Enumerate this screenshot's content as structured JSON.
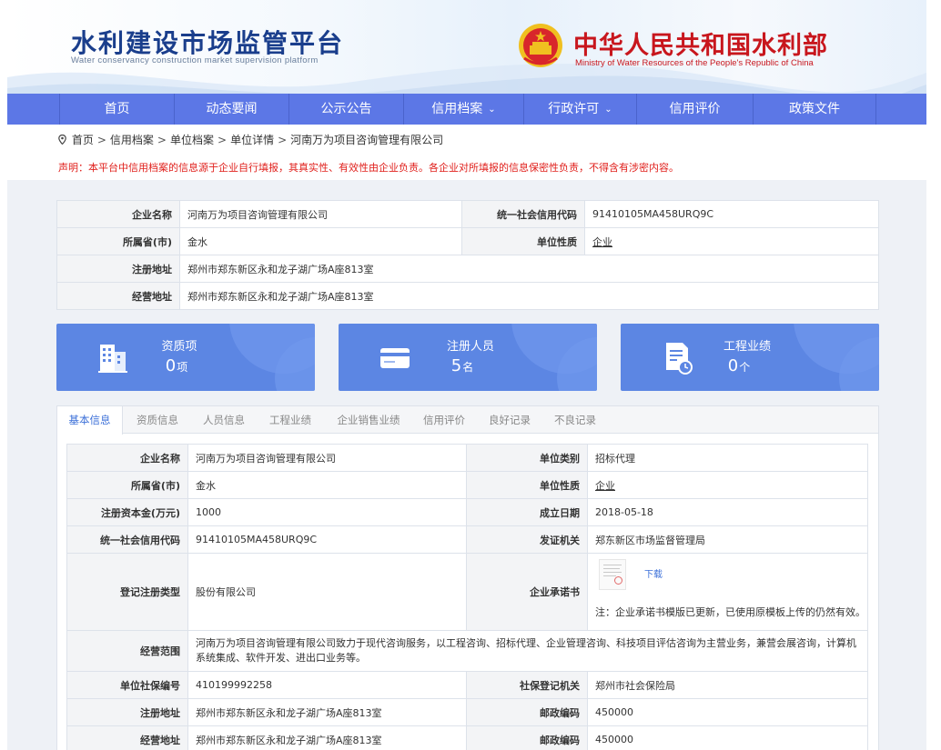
{
  "header": {
    "site_title": "水利建设市场监管平台",
    "site_subtitle": "Water conservancy construction market supervision platform",
    "ministry_cn": "中华人民共和国水利部",
    "ministry_en": "Ministry of Water Resources of the People's Republic of China"
  },
  "nav": {
    "items": [
      {
        "label": "首页"
      },
      {
        "label": "动态要闻"
      },
      {
        "label": "公示公告"
      },
      {
        "label": "信用档案",
        "dropdown": true
      },
      {
        "label": "行政许可",
        "dropdown": true
      },
      {
        "label": "信用评价"
      },
      {
        "label": "政策文件"
      }
    ],
    "chevron": "⌄",
    "colors": {
      "bar": "#5c77e6"
    }
  },
  "breadcrumb": {
    "items": [
      "首页",
      "信用档案",
      "单位档案",
      "单位详情",
      "河南万为项目咨询管理有限公司"
    ],
    "separator": ">"
  },
  "notice": "声明：本平台中信用档案的信息源于企业自行填报，其真实性、有效性由企业负责。各企业对所填报的信息保密性负责，不得含有涉密内容。",
  "summary": {
    "rows": [
      {
        "l1": "企业名称",
        "v1": "河南万为项目咨询管理有限公司",
        "l2": "统一社会信用代码",
        "v2": "91410105MA458URQ9C"
      },
      {
        "l1": "所属省(市)",
        "v1": "金水",
        "l2": "单位性质",
        "v2": "企业"
      },
      {
        "l1": "注册地址",
        "v1": "郑州市郑东新区永和龙子湖广场A座813室"
      },
      {
        "l1": "经营地址",
        "v1": "郑州市郑东新区永和龙子湖广场A座813室"
      }
    ]
  },
  "cards": [
    {
      "label": "资质项",
      "value": "0",
      "unit": "项",
      "icon": "building-icon"
    },
    {
      "label": "注册人员",
      "value": "5",
      "unit": "名",
      "icon": "id-card-icon"
    },
    {
      "label": "工程业绩",
      "value": "0",
      "unit": "个",
      "icon": "document-clock-icon"
    }
  ],
  "tabs": [
    "基本信息",
    "资质信息",
    "人员信息",
    "工程业绩",
    "企业销售业绩",
    "信用评价",
    "良好记录",
    "不良记录"
  ],
  "detail": {
    "company_name_label": "企业名称",
    "company_name": "河南万为项目咨询管理有限公司",
    "unit_category_label": "单位类别",
    "unit_category": "招标代理",
    "province_label": "所属省(市)",
    "province": "金水",
    "unit_nature_label": "单位性质",
    "unit_nature": "企业",
    "capital_label": "注册资本金(万元)",
    "capital": "1000",
    "founded_label": "成立日期",
    "founded": "2018-05-18",
    "credit_code_label": "统一社会信用代码",
    "credit_code": "91410105MA458URQ9C",
    "issuer_label": "发证机关",
    "issuer": "郑东新区市场监督管理局",
    "reg_type_label": "登记注册类型",
    "reg_type": "股份有限公司",
    "commitment_label": "企业承诺书",
    "commitment_download": "下载",
    "commitment_note": "注：企业承诺书模版已更新，已使用原模板上传的仍然有效。",
    "scope_label": "经营范围",
    "scope": "河南万为项目咨询管理有限公司致力于现代咨询服务，以工程咨询、招标代理、企业管理咨询、科技项目评估咨询为主营业务，兼营会展咨询，计算机系统集成、软件开发、进出口业务等。",
    "social_no_label": "单位社保编号",
    "social_no": "410199992258",
    "social_org_label": "社保登记机关",
    "social_org": "郑州市社会保险局",
    "reg_addr_label": "注册地址",
    "reg_addr": "郑州市郑东新区永和龙子湖广场A座813室",
    "zip1_label": "邮政编码",
    "zip1": "450000",
    "biz_addr_label": "经营地址",
    "biz_addr": "郑州市郑东新区永和龙子湖广场A座813室",
    "zip2_label": "邮政编码",
    "zip2": "450000"
  }
}
